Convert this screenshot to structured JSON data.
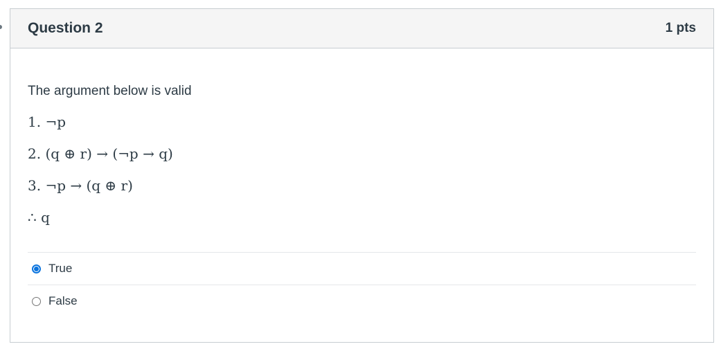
{
  "question": {
    "title": "Question 2",
    "points": "1 pts",
    "prompt": "The argument below is valid",
    "lines": [
      "1. ¬p",
      "2. (q ⊕ r) → (¬p → q)",
      "3. ¬p → (q ⊕ r)",
      "∴ q"
    ]
  },
  "answers": [
    {
      "label": "True",
      "selected": true
    },
    {
      "label": "False",
      "selected": false
    }
  ],
  "colors": {
    "accent": "#0b74de",
    "header_bg": "#f5f5f5",
    "border": "#c7cdd1",
    "text": "#2d3b45"
  }
}
